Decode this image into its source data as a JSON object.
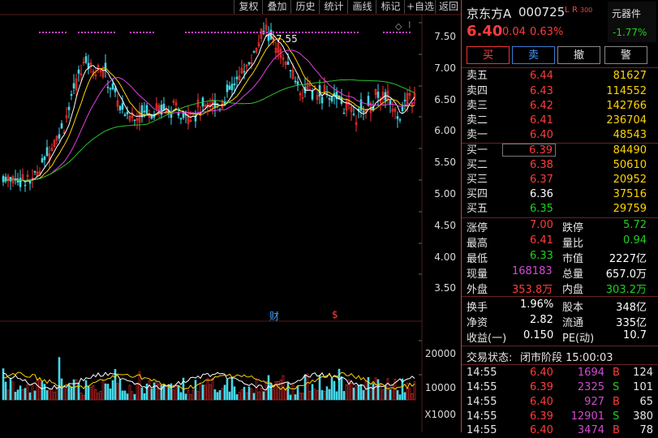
{
  "toolbar": {
    "items": [
      "复权",
      "叠加",
      "历史",
      "统计",
      "画线",
      "标记",
      "+自选",
      "返回"
    ]
  },
  "chart": {
    "price_ticks": [
      "7.50",
      "7.00",
      "6.50",
      "6.00",
      "5.50",
      "5.00",
      "4.50",
      "4.00",
      "3.50"
    ],
    "volume_ticks": [
      "20000",
      "10000"
    ],
    "volume_unit": "X1000",
    "peak_label": "7.55",
    "event_marks": [
      "财",
      "$"
    ]
  },
  "quote": {
    "name": "京东方A",
    "code": "000725",
    "badge_l": "L",
    "badge_r": "R",
    "badge_num": "300",
    "price": "6.40",
    "change": "0.04",
    "change_pct": "0.63%",
    "side_label": "元器件",
    "side_pct": "-1.77%"
  },
  "actions": [
    "买",
    "卖",
    "撤",
    "警"
  ],
  "asks": [
    {
      "label": "卖五",
      "price": "6.44",
      "vol": "81627"
    },
    {
      "label": "卖四",
      "price": "6.43",
      "vol": "114552"
    },
    {
      "label": "卖三",
      "price": "6.42",
      "vol": "142766"
    },
    {
      "label": "卖二",
      "price": "6.41",
      "vol": "236704"
    },
    {
      "label": "卖一",
      "price": "6.40",
      "vol": "48543"
    }
  ],
  "bids": [
    {
      "label": "买一",
      "price": "6.39",
      "vol": "84490"
    },
    {
      "label": "买二",
      "price": "6.38",
      "vol": "50610"
    },
    {
      "label": "买三",
      "price": "6.37",
      "vol": "20952"
    },
    {
      "label": "买四",
      "price": "6.36",
      "vol": "37516"
    },
    {
      "label": "买五",
      "price": "6.35",
      "vol": "29759"
    }
  ],
  "stats": {
    "limit_up_l": "涨停",
    "limit_up": "7.00",
    "limit_dn_l": "跌停",
    "limit_dn": "5.72",
    "high_l": "最高",
    "high": "6.41",
    "vr_l": "量比",
    "vr": "0.94",
    "low_l": "最低",
    "low": "6.33",
    "mcap_l": "市值",
    "mcap": "2227亿",
    "cur_l": "现量",
    "cur": "168183",
    "tvol_l": "总量",
    "tvol": "657.0万",
    "out_l": "外盘",
    "out": "353.8万",
    "in_l": "内盘",
    "in": "303.2万",
    "turn_l": "换手",
    "turn": "1.96%",
    "shares_l": "股本",
    "shares": "348亿",
    "nav_l": "净资",
    "nav": "2.82",
    "float_l": "流通",
    "float": "335亿",
    "eps_l": "收益(一)",
    "eps": "0.150",
    "pe_l": "PE(动)",
    "pe": "10.7"
  },
  "status": {
    "label": "交易状态:",
    "value": "闭市阶段 15:00:03"
  },
  "ticks": [
    {
      "time": "14:55",
      "price": "6.40",
      "vol": "1694",
      "bs": "B",
      "n": "124"
    },
    {
      "time": "14:55",
      "price": "6.39",
      "vol": "2325",
      "bs": "S",
      "n": "101"
    },
    {
      "time": "14:55",
      "price": "6.40",
      "vol": "927",
      "bs": "B",
      "n": "65"
    },
    {
      "time": "14:55",
      "price": "6.39",
      "vol": "12901",
      "bs": "S",
      "n": "380"
    },
    {
      "time": "14:55",
      "price": "6.40",
      "vol": "3474",
      "bs": "B",
      "n": "78"
    }
  ]
}
